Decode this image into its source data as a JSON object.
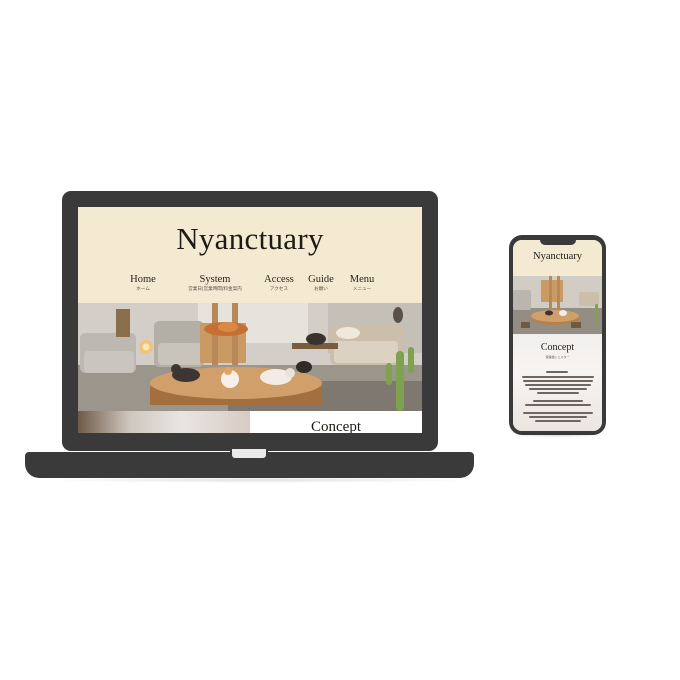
{
  "laptop": {
    "brand": "Nyanctuary",
    "nav": [
      {
        "label": "Home",
        "sub": "ホーム"
      },
      {
        "label": "System",
        "sub": "営業日|営業時間|料金案内"
      },
      {
        "label": "Access",
        "sub": "アクセス"
      },
      {
        "label": "Guide",
        "sub": "お願い"
      },
      {
        "label": "Menu",
        "sub": "メニュー"
      }
    ],
    "concept_title": "Concept"
  },
  "phone": {
    "brand": "Nyanctuary",
    "concept_title": "Concept",
    "concept_sub": "保護猫シェルター"
  },
  "colors": {
    "device": "#3a3a3a",
    "header_bg": "#f3ead1",
    "text": "#1e1a16"
  }
}
